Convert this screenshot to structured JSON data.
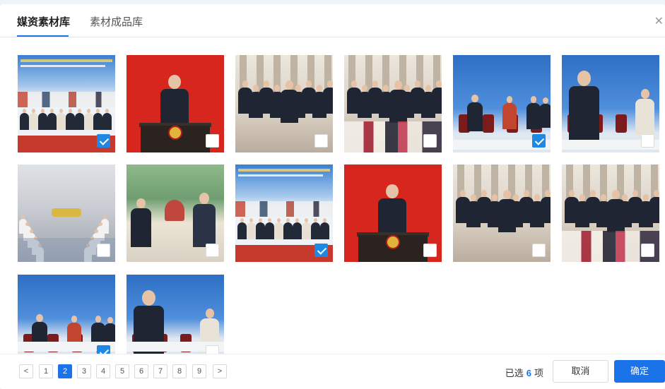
{
  "tabs": [
    {
      "label": "媒资素材库",
      "active": true
    },
    {
      "label": "素材成品库",
      "active": false
    }
  ],
  "close_icon": "close-icon",
  "images": [
    {
      "scene": "winter-games-banner",
      "checked": true
    },
    {
      "scene": "podium-speech",
      "checked": false
    },
    {
      "scene": "hall-walking-group",
      "checked": false
    },
    {
      "scene": "hall-group-with-crowd",
      "checked": false
    },
    {
      "scene": "blue-stage-seated",
      "checked": true
    },
    {
      "scene": "blue-stage-waving",
      "checked": false
    },
    {
      "scene": "meeting-room",
      "checked": false
    },
    {
      "scene": "garden-meeting",
      "checked": false
    },
    {
      "scene": "winter-games-banner",
      "checked": true
    },
    {
      "scene": "podium-speech",
      "checked": false
    },
    {
      "scene": "hall-walking-group",
      "checked": false
    },
    {
      "scene": "hall-group-with-crowd",
      "checked": false
    },
    {
      "scene": "blue-stage-seated",
      "checked": true
    },
    {
      "scene": "blue-stage-waving",
      "checked": false
    }
  ],
  "pagination": {
    "prev": "<",
    "next": ">",
    "pages": [
      "1",
      "2",
      "3",
      "4",
      "5",
      "6",
      "7",
      "8",
      "9"
    ],
    "current": "2"
  },
  "footer": {
    "selected_prefix": "已选",
    "selected_count": "6",
    "selected_suffix": "项",
    "cancel_label": "取消",
    "ok_label": "确定"
  },
  "colors": {
    "accent": "#1a73e8",
    "check": "#1e88e5",
    "podium_red": "#d7261e"
  }
}
